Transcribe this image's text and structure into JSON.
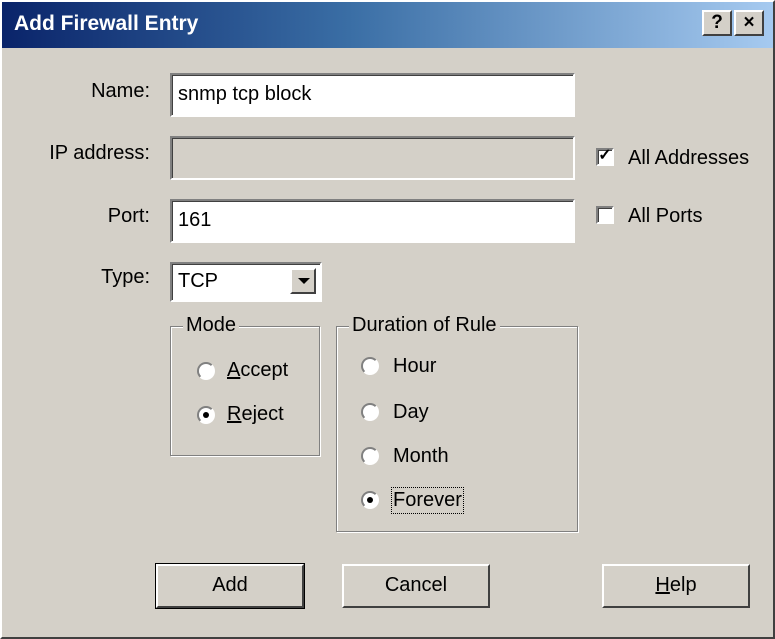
{
  "window": {
    "title": "Add Firewall Entry",
    "help_glyph": "?",
    "close_glyph": "×",
    "bg_color": "#d4d0c8",
    "title_color": "#0a246a"
  },
  "form": {
    "name": {
      "label": "Name:",
      "value": "snmp tcp block"
    },
    "ip": {
      "label": "IP address:",
      "value": "",
      "disabled": true
    },
    "all_addresses": {
      "label": "All Addresses",
      "checked": true
    },
    "port": {
      "label": "Port:",
      "value": "161"
    },
    "all_ports": {
      "label": "All Ports",
      "checked": false
    },
    "type": {
      "label": "Type:",
      "selected": "TCP"
    }
  },
  "mode": {
    "title": "Mode",
    "options": [
      {
        "label": "Accept",
        "checked": false
      },
      {
        "label": "Reject",
        "checked": true
      }
    ]
  },
  "duration": {
    "title": "Duration of Rule",
    "options": [
      {
        "label": "Hour",
        "checked": false
      },
      {
        "label": "Day",
        "checked": false
      },
      {
        "label": "Month",
        "checked": false
      },
      {
        "label": "Forever",
        "checked": true
      }
    ]
  },
  "buttons": {
    "add": "Add",
    "cancel": "Cancel",
    "help": "Help"
  }
}
